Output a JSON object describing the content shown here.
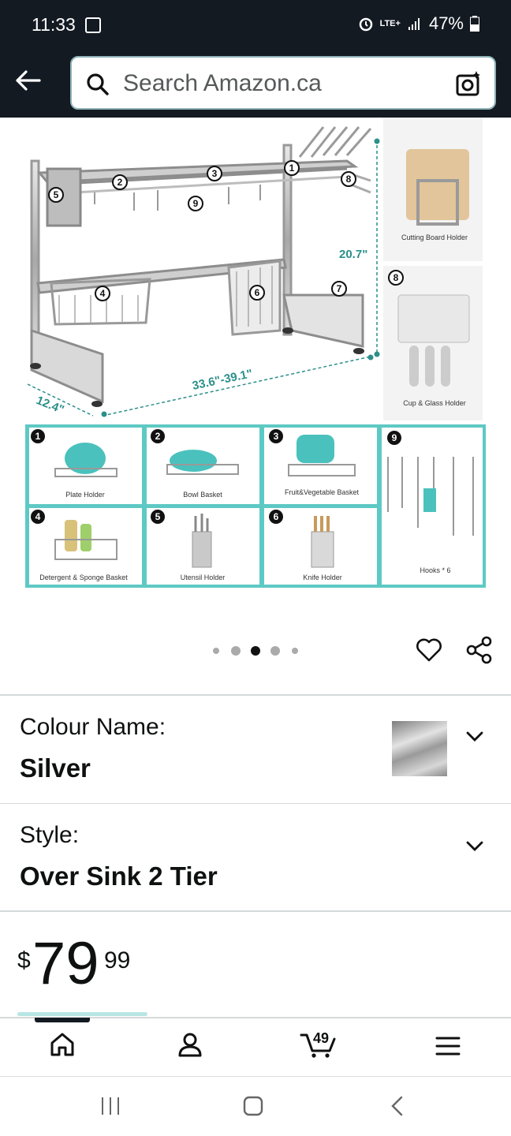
{
  "status": {
    "time": "11:33",
    "battery": "47%",
    "network": "LTE+"
  },
  "search": {
    "placeholder": "Search Amazon.ca"
  },
  "hero": {
    "dimensions": {
      "height": "20.7\"",
      "length": "33.6\"-39.1\"",
      "depth": "12.4\""
    },
    "side_labels": [
      "Cutting Board Holder",
      "Cup & Glass Holder"
    ],
    "parts": [
      {
        "num": "1",
        "label": "Plate Holder"
      },
      {
        "num": "2",
        "label": "Bowl Basket"
      },
      {
        "num": "3",
        "label": "Fruit&Vegetable Basket"
      },
      {
        "num": "4",
        "label": "Detergent & Sponge Basket"
      },
      {
        "num": "5",
        "label": "Utensil Holder"
      },
      {
        "num": "6",
        "label": "Knife Holder"
      },
      {
        "num": "9",
        "label": "Hooks * 6"
      }
    ],
    "side_nums": [
      "7",
      "8"
    ],
    "diagram_nums": [
      "1",
      "2",
      "3",
      "4",
      "5",
      "6",
      "7",
      "8",
      "9"
    ]
  },
  "carousel": {
    "count": 5,
    "active": 2
  },
  "options": [
    {
      "label": "Colour Name:",
      "value": "Silver"
    },
    {
      "label": "Style:",
      "value": "Over Sink 2 Tier"
    }
  ],
  "price": {
    "symbol": "$",
    "whole": "79",
    "fraction": "99"
  },
  "nav": {
    "cart_count": "49"
  },
  "colors": {
    "topbar": "#131a22",
    "teal": "#5ec9c4"
  }
}
